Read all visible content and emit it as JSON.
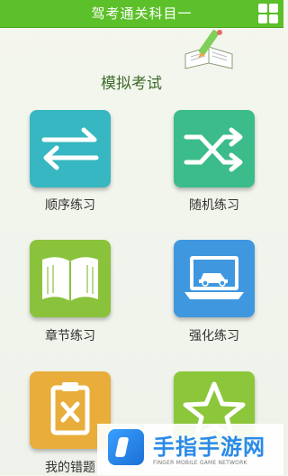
{
  "header": {
    "title": "驾考通关科目一",
    "menu_icon": "grid-icon"
  },
  "banner": {
    "label": "模拟考试",
    "icon": "pen-book-icon"
  },
  "tiles": [
    {
      "label": "顺序练习",
      "icon": "arrows-swap-icon",
      "color": "#36b7c1"
    },
    {
      "label": "随机练习",
      "icon": "shuffle-icon",
      "color": "#3cbc8a"
    },
    {
      "label": "章节练习",
      "icon": "open-book-icon",
      "color": "#8ac23c"
    },
    {
      "label": "强化练习",
      "icon": "laptop-car-icon",
      "color": "#3f97e0"
    },
    {
      "label": "我的错题",
      "icon": "clipboard-x-icon",
      "color": "#e8ad3a"
    },
    {
      "label": "",
      "icon": "star-icon",
      "color": "#8cc63a"
    }
  ],
  "watermark": {
    "title": "手指手游网",
    "subtitle": "FINGER MOBILE GAME NETWORK"
  }
}
